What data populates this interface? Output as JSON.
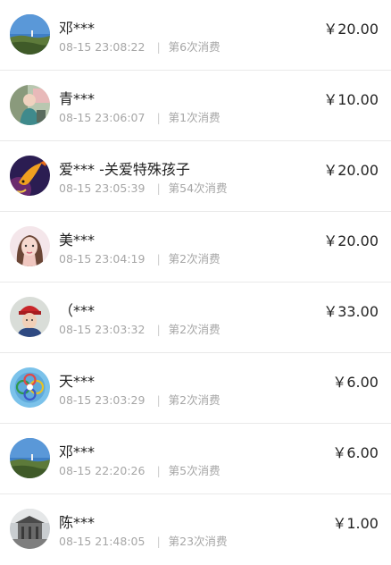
{
  "donations": [
    {
      "name": "邓***",
      "time": "08-15 23:08:22",
      "count": "第6次消费",
      "amount": "￥20.00",
      "avatar": "landscape-avatar-icon"
    },
    {
      "name": "青***",
      "time": "08-15 23:06:07",
      "count": "第1次消费",
      "amount": "￥10.00",
      "avatar": "person-avatar-icon"
    },
    {
      "name": "爱*** -关爱特殊孩子",
      "time": "08-15 23:05:39",
      "count": "第54次消费",
      "amount": "￥20.00",
      "avatar": "koi-fish-avatar-icon"
    },
    {
      "name": "美***",
      "time": "08-15 23:04:19",
      "count": "第2次消费",
      "amount": "￥20.00",
      "avatar": "woman-avatar-icon"
    },
    {
      "name": "（***",
      "time": "08-15 23:03:32",
      "count": "第2次消费",
      "amount": "￥33.00",
      "avatar": "woman-red-hat-avatar-icon"
    },
    {
      "name": "天***",
      "time": "08-15 23:03:29",
      "count": "第2次消费",
      "amount": "￥6.00",
      "avatar": "rings-emblem-avatar-icon"
    },
    {
      "name": "邓***",
      "time": "08-15 22:20:26",
      "count": "第5次消费",
      "amount": "￥6.00",
      "avatar": "landscape-avatar-icon"
    },
    {
      "name": "陈***",
      "time": "08-15 21:48:05",
      "count": "第23次消费",
      "amount": "￥1.00",
      "avatar": "building-avatar-icon"
    }
  ]
}
